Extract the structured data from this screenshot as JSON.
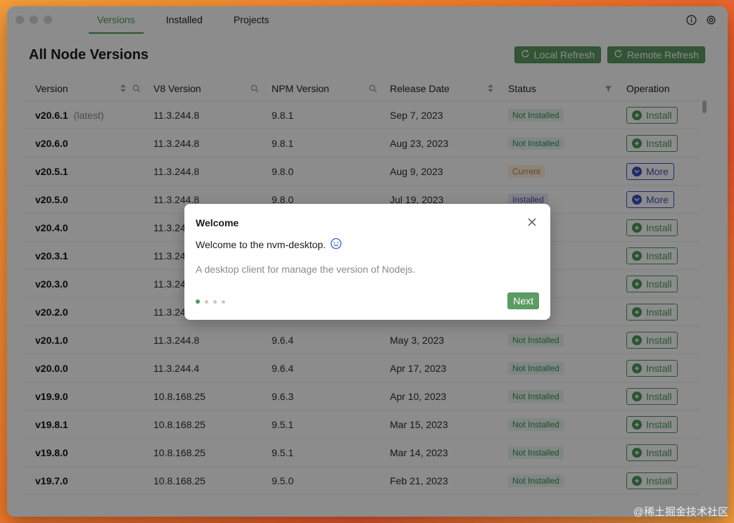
{
  "tabs": [
    "Versions",
    "Installed",
    "Projects"
  ],
  "page_title": "All Node Versions",
  "actions": {
    "local_refresh": "Local Refresh",
    "remote_refresh": "Remote Refresh"
  },
  "columns": [
    "Version",
    "V8 Version",
    "NPM Version",
    "Release Date",
    "Status",
    "Operation"
  ],
  "latest_label": "(latest)",
  "rows": [
    {
      "version": "v20.6.1",
      "latest": true,
      "v8": "11.3.244.8",
      "npm": "9.8.1",
      "date": "Sep 7, 2023",
      "status": "Not Installed",
      "op": "Install"
    },
    {
      "version": "v20.6.0",
      "latest": false,
      "v8": "11.3.244.8",
      "npm": "9.8.1",
      "date": "Aug 23, 2023",
      "status": "Not Installed",
      "op": "Install"
    },
    {
      "version": "v20.5.1",
      "latest": false,
      "v8": "11.3.244.8",
      "npm": "9.8.0",
      "date": "Aug 9, 2023",
      "status": "Current",
      "op": "More"
    },
    {
      "version": "v20.5.0",
      "latest": false,
      "v8": "11.3.244.8",
      "npm": "9.8.0",
      "date": "Jul 19, 2023",
      "status": "Installed",
      "op": "More"
    },
    {
      "version": "v20.4.0",
      "latest": false,
      "v8": "11.3.24",
      "npm": "",
      "date": "",
      "status": "",
      "op": "Install"
    },
    {
      "version": "v20.3.1",
      "latest": false,
      "v8": "11.3.24",
      "npm": "",
      "date": "",
      "status": "",
      "op": "Install"
    },
    {
      "version": "v20.3.0",
      "latest": false,
      "v8": "11.3.24",
      "npm": "",
      "date": "",
      "status": "",
      "op": "Install"
    },
    {
      "version": "v20.2.0",
      "latest": false,
      "v8": "11.3.24",
      "npm": "",
      "date": "",
      "status": "",
      "op": "Install"
    },
    {
      "version": "v20.1.0",
      "latest": false,
      "v8": "11.3.244.8",
      "npm": "9.6.4",
      "date": "May 3, 2023",
      "status": "Not Installed",
      "op": "Install"
    },
    {
      "version": "v20.0.0",
      "latest": false,
      "v8": "11.3.244.4",
      "npm": "9.6.4",
      "date": "Apr 17, 2023",
      "status": "Not Installed",
      "op": "Install"
    },
    {
      "version": "v19.9.0",
      "latest": false,
      "v8": "10.8.168.25",
      "npm": "9.6.3",
      "date": "Apr 10, 2023",
      "status": "Not Installed",
      "op": "Install"
    },
    {
      "version": "v19.8.1",
      "latest": false,
      "v8": "10.8.168.25",
      "npm": "9.5.1",
      "date": "Mar 15, 2023",
      "status": "Not Installed",
      "op": "Install"
    },
    {
      "version": "v19.8.0",
      "latest": false,
      "v8": "10.8.168.25",
      "npm": "9.5.1",
      "date": "Mar 14, 2023",
      "status": "Not Installed",
      "op": "Install"
    },
    {
      "version": "v19.7.0",
      "latest": false,
      "v8": "10.8.168.25",
      "npm": "9.5.0",
      "date": "Feb 21, 2023",
      "status": "Not Installed",
      "op": "Install"
    }
  ],
  "modal": {
    "title": "Welcome",
    "heading": "Welcome to the nvm-desktop.",
    "description": "A desktop client for manage the version of Nodejs.",
    "next_label": "Next",
    "step_count": 4,
    "active_step": 1
  },
  "watermark": "@稀土掘金技术社区",
  "colors": {
    "accent": "#4a9c5a",
    "more": "#3a52c4",
    "current": "#cf7a2a"
  }
}
